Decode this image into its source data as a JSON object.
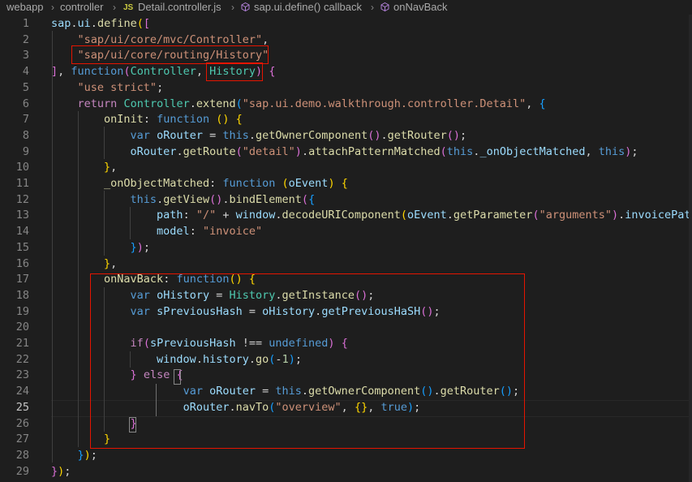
{
  "breadcrumb": {
    "items": [
      "webapp",
      "controller",
      "Detail.controller.js",
      "sap.ui.define() callback",
      "onNavBack"
    ],
    "file_badge": "JS"
  },
  "editor": {
    "active_line": 25,
    "lines": [
      {
        "n": "1",
        "tokens": [
          [
            "v",
            "sap"
          ],
          [
            "",
            "."
          ],
          [
            "v",
            "ui"
          ],
          [
            "",
            "."
          ],
          [
            "f",
            "define"
          ],
          [
            "b1",
            "("
          ],
          [
            "b2",
            "["
          ]
        ]
      },
      {
        "n": "2",
        "tokens": [
          [
            "",
            "    "
          ],
          [
            "s",
            "\"sap/ui/core/mvc/Controller\""
          ],
          [
            "",
            ","
          ]
        ]
      },
      {
        "n": "3",
        "tokens": [
          [
            "",
            "    "
          ],
          [
            "s",
            "\"sap/ui/core/routing/History\""
          ]
        ]
      },
      {
        "n": "4",
        "tokens": [
          [
            "b2",
            "]"
          ],
          [
            "",
            ", "
          ],
          [
            "k",
            "function"
          ],
          [
            "",
            "",
            " "
          ],
          [
            "b2",
            "("
          ],
          [
            "t",
            "Controller"
          ],
          [
            "",
            ", "
          ],
          [
            "t",
            "History"
          ],
          [
            "b2",
            ")"
          ],
          [
            "",
            " "
          ],
          [
            "b2",
            "{"
          ]
        ]
      },
      {
        "n": "5",
        "tokens": [
          [
            "",
            "    "
          ],
          [
            "s",
            "\"use strict\""
          ],
          [
            "",
            ";"
          ]
        ]
      },
      {
        "n": "6",
        "tokens": [
          [
            "",
            "    "
          ],
          [
            "c",
            "return"
          ],
          [
            "",
            " "
          ],
          [
            "t",
            "Controller"
          ],
          [
            "",
            "."
          ],
          [
            "f",
            "extend"
          ],
          [
            "b3",
            "("
          ],
          [
            "s",
            "\"sap.ui.demo.walkthrough.controller.Detail\""
          ],
          [
            "",
            ", "
          ],
          [
            "b3",
            "{"
          ]
        ]
      },
      {
        "n": "7",
        "tokens": [
          [
            "",
            "        "
          ],
          [
            "f",
            "onInit"
          ],
          [
            "",
            ": "
          ],
          [
            "k",
            "function"
          ],
          [
            "",
            " "
          ],
          [
            "b1",
            "()"
          ],
          [
            "",
            " "
          ],
          [
            "b1",
            "{"
          ]
        ]
      },
      {
        "n": "8",
        "tokens": [
          [
            "",
            "            "
          ],
          [
            "k",
            "var"
          ],
          [
            "",
            " "
          ],
          [
            "v",
            "oRouter"
          ],
          [
            "",
            " = "
          ],
          [
            "k",
            "this"
          ],
          [
            "",
            "."
          ],
          [
            "f",
            "getOwnerComponent"
          ],
          [
            "b2",
            "()"
          ],
          [
            "",
            "."
          ],
          [
            "f",
            "getRouter"
          ],
          [
            "b2",
            "()"
          ],
          [
            "",
            ";"
          ]
        ]
      },
      {
        "n": "9",
        "tokens": [
          [
            "",
            "            "
          ],
          [
            "v",
            "oRouter"
          ],
          [
            "",
            "."
          ],
          [
            "f",
            "getRoute"
          ],
          [
            "b2",
            "("
          ],
          [
            "s",
            "\"detail\""
          ],
          [
            "b2",
            ")"
          ],
          [
            "",
            "."
          ],
          [
            "f",
            "attachPatternMatched"
          ],
          [
            "b2",
            "("
          ],
          [
            "k",
            "this"
          ],
          [
            "",
            "."
          ],
          [
            "v",
            "_onObjectMatched"
          ],
          [
            "",
            ", "
          ],
          [
            "k",
            "this"
          ],
          [
            "b2",
            ")"
          ],
          [
            "",
            ";"
          ]
        ]
      },
      {
        "n": "10",
        "tokens": [
          [
            "",
            "        "
          ],
          [
            "b1",
            "}"
          ],
          [
            "",
            ","
          ]
        ]
      },
      {
        "n": "11",
        "tokens": [
          [
            "",
            "        "
          ],
          [
            "f",
            "_onObjectMatched"
          ],
          [
            "",
            ": "
          ],
          [
            "k",
            "function"
          ],
          [
            "",
            " "
          ],
          [
            "b1",
            "("
          ],
          [
            "v",
            "oEvent"
          ],
          [
            "b1",
            ")"
          ],
          [
            "",
            " "
          ],
          [
            "b1",
            "{"
          ]
        ]
      },
      {
        "n": "12",
        "tokens": [
          [
            "",
            "            "
          ],
          [
            "k",
            "this"
          ],
          [
            "",
            "."
          ],
          [
            "f",
            "getView"
          ],
          [
            "b2",
            "()"
          ],
          [
            "",
            "."
          ],
          [
            "f",
            "bindElement"
          ],
          [
            "b2",
            "("
          ],
          [
            "b3",
            "{"
          ]
        ]
      },
      {
        "n": "13",
        "tokens": [
          [
            "",
            "                "
          ],
          [
            "v",
            "path"
          ],
          [
            "",
            ": "
          ],
          [
            "s",
            "\"/\""
          ],
          [
            "",
            " + "
          ],
          [
            "v",
            "window"
          ],
          [
            "",
            "."
          ],
          [
            "f",
            "decodeURIComponent"
          ],
          [
            "b1",
            "("
          ],
          [
            "v",
            "oEvent"
          ],
          [
            "",
            "."
          ],
          [
            "f",
            "getParameter"
          ],
          [
            "b2",
            "("
          ],
          [
            "s",
            "\"arguments\""
          ],
          [
            "b2",
            ")"
          ],
          [
            "",
            "."
          ],
          [
            "v",
            "invoicePath"
          ]
        ]
      },
      {
        "n": "14",
        "tokens": [
          [
            "",
            "                "
          ],
          [
            "v",
            "model"
          ],
          [
            "",
            ": "
          ],
          [
            "s",
            "\"invoice\""
          ]
        ]
      },
      {
        "n": "15",
        "tokens": [
          [
            "",
            "            "
          ],
          [
            "b3",
            "}"
          ],
          [
            "b2",
            ")"
          ],
          [
            "",
            ";"
          ]
        ]
      },
      {
        "n": "16",
        "tokens": [
          [
            "",
            "        "
          ],
          [
            "b1",
            "}"
          ],
          [
            "",
            ","
          ]
        ]
      },
      {
        "n": "17",
        "tokens": [
          [
            "",
            "        "
          ],
          [
            "f",
            "onNavBack"
          ],
          [
            "",
            ": "
          ],
          [
            "k",
            "function"
          ],
          [
            "b1",
            "()"
          ],
          [
            "",
            " "
          ],
          [
            "b1",
            "{"
          ]
        ]
      },
      {
        "n": "18",
        "tokens": [
          [
            "",
            "            "
          ],
          [
            "k",
            "var"
          ],
          [
            "",
            " "
          ],
          [
            "v",
            "oHistory"
          ],
          [
            "",
            " = "
          ],
          [
            "t",
            "History"
          ],
          [
            "",
            "."
          ],
          [
            "f",
            "getInstance"
          ],
          [
            "b2",
            "()"
          ],
          [
            "",
            ";"
          ]
        ]
      },
      {
        "n": "19",
        "tokens": [
          [
            "",
            "            "
          ],
          [
            "k",
            "var"
          ],
          [
            "",
            " "
          ],
          [
            "v",
            "sPreviousHash"
          ],
          [
            "",
            " = "
          ],
          [
            "v",
            "oHistory"
          ],
          [
            "",
            "."
          ],
          [
            "v",
            "getPreviousHaSH"
          ],
          [
            "b2",
            "()"
          ],
          [
            "",
            ";"
          ]
        ]
      },
      {
        "n": "20",
        "tokens": []
      },
      {
        "n": "21",
        "tokens": [
          [
            "",
            "            "
          ],
          [
            "c",
            "if"
          ],
          [
            "b2",
            "("
          ],
          [
            "v",
            "sPreviousHash"
          ],
          [
            "",
            " !== "
          ],
          [
            "k",
            "undefined"
          ],
          [
            "b2",
            ")"
          ],
          [
            "",
            " "
          ],
          [
            "b2",
            "{"
          ]
        ]
      },
      {
        "n": "22",
        "tokens": [
          [
            "",
            "                "
          ],
          [
            "v",
            "window"
          ],
          [
            "",
            "."
          ],
          [
            "v",
            "history"
          ],
          [
            "",
            "."
          ],
          [
            "f",
            "go"
          ],
          [
            "b3",
            "("
          ],
          [
            "",
            "-"
          ],
          [
            "n",
            "1"
          ],
          [
            "b3",
            ")"
          ],
          [
            "",
            ";"
          ]
        ]
      },
      {
        "n": "23",
        "tokens": [
          [
            "",
            "            "
          ],
          [
            "b2",
            "}"
          ],
          [
            "",
            " "
          ],
          [
            "c",
            "else"
          ],
          [
            "",
            " "
          ],
          [
            "b2",
            "{"
          ]
        ]
      },
      {
        "n": "24",
        "tokens": [
          [
            "",
            "                    "
          ],
          [
            "k",
            "var"
          ],
          [
            "",
            " "
          ],
          [
            "v",
            "oRouter"
          ],
          [
            "",
            " = "
          ],
          [
            "k",
            "this"
          ],
          [
            "",
            "."
          ],
          [
            "f",
            "getOwnerComponent"
          ],
          [
            "b3",
            "()"
          ],
          [
            "",
            "."
          ],
          [
            "f",
            "getRouter"
          ],
          [
            "b3",
            "()"
          ],
          [
            "",
            ";"
          ]
        ]
      },
      {
        "n": "25",
        "tokens": [
          [
            "",
            "                    "
          ],
          [
            "v",
            "oRouter"
          ],
          [
            "",
            "."
          ],
          [
            "f",
            "navTo"
          ],
          [
            "b3",
            "("
          ],
          [
            "s",
            "\"overview\""
          ],
          [
            "",
            ", "
          ],
          [
            "b1",
            "{}"
          ],
          [
            "",
            ", "
          ],
          [
            "k",
            "true"
          ],
          [
            "b3",
            ")"
          ],
          [
            "",
            ";"
          ]
        ]
      },
      {
        "n": "26",
        "tokens": [
          [
            "",
            "            "
          ],
          [
            "b2",
            "}"
          ]
        ]
      },
      {
        "n": "27",
        "tokens": [
          [
            "",
            "        "
          ],
          [
            "b1",
            "}"
          ]
        ]
      },
      {
        "n": "28",
        "tokens": [
          [
            "",
            "    "
          ],
          [
            "b3",
            "}"
          ],
          [
            "b1",
            ")"
          ],
          [
            "",
            ";"
          ]
        ]
      },
      {
        "n": "29",
        "tokens": [
          [
            "b2",
            "}"
          ],
          [
            "b1",
            ")"
          ],
          [
            "",
            ";"
          ]
        ]
      }
    ]
  },
  "colors": {
    "background": "#1e1e1e",
    "highlight_box": "#e51400"
  },
  "icons": {
    "breadcrumb_separator": "chevron-right-icon",
    "symbol": "cube-icon"
  }
}
